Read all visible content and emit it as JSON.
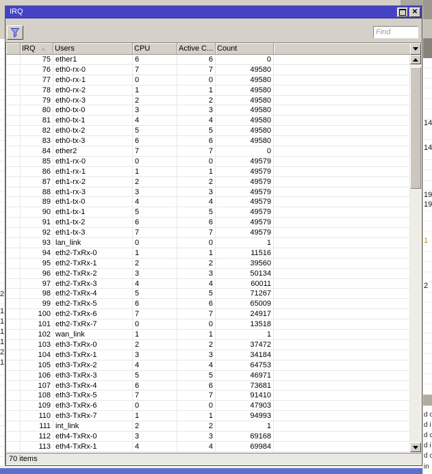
{
  "window": {
    "title": "IRQ"
  },
  "titlebar": {
    "maximize_icon": "maximize",
    "close_icon": "close"
  },
  "toolbar": {
    "find_placeholder": "Find",
    "filter_icon": "funnel"
  },
  "table": {
    "columns": [
      "",
      "IRQ",
      "Users",
      "CPU",
      "Active C...",
      "Count"
    ],
    "sort": {
      "column": "IRQ",
      "direction": "asc"
    },
    "rows": [
      {
        "irq": 75,
        "users": "ether1",
        "cpu": 6,
        "active_cpu": 6,
        "count": 0
      },
      {
        "irq": 76,
        "users": "eth0-rx-0",
        "cpu": 7,
        "active_cpu": 7,
        "count": 49580
      },
      {
        "irq": 77,
        "users": "eth0-rx-1",
        "cpu": 0,
        "active_cpu": 0,
        "count": 49580
      },
      {
        "irq": 78,
        "users": "eth0-rx-2",
        "cpu": 1,
        "active_cpu": 1,
        "count": 49580
      },
      {
        "irq": 79,
        "users": "eth0-rx-3",
        "cpu": 2,
        "active_cpu": 2,
        "count": 49580
      },
      {
        "irq": 80,
        "users": "eth0-tx-0",
        "cpu": 3,
        "active_cpu": 3,
        "count": 49580
      },
      {
        "irq": 81,
        "users": "eth0-tx-1",
        "cpu": 4,
        "active_cpu": 4,
        "count": 49580
      },
      {
        "irq": 82,
        "users": "eth0-tx-2",
        "cpu": 5,
        "active_cpu": 5,
        "count": 49580
      },
      {
        "irq": 83,
        "users": "eth0-tx-3",
        "cpu": 6,
        "active_cpu": 6,
        "count": 49580
      },
      {
        "irq": 84,
        "users": "ether2",
        "cpu": 7,
        "active_cpu": 7,
        "count": 0
      },
      {
        "irq": 85,
        "users": "eth1-rx-0",
        "cpu": 0,
        "active_cpu": 0,
        "count": 49579
      },
      {
        "irq": 86,
        "users": "eth1-rx-1",
        "cpu": 1,
        "active_cpu": 1,
        "count": 49579
      },
      {
        "irq": 87,
        "users": "eth1-rx-2",
        "cpu": 2,
        "active_cpu": 2,
        "count": 49579
      },
      {
        "irq": 88,
        "users": "eth1-rx-3",
        "cpu": 3,
        "active_cpu": 3,
        "count": 49579
      },
      {
        "irq": 89,
        "users": "eth1-tx-0",
        "cpu": 4,
        "active_cpu": 4,
        "count": 49579
      },
      {
        "irq": 90,
        "users": "eth1-tx-1",
        "cpu": 5,
        "active_cpu": 5,
        "count": 49579
      },
      {
        "irq": 91,
        "users": "eth1-tx-2",
        "cpu": 6,
        "active_cpu": 6,
        "count": 49579
      },
      {
        "irq": 92,
        "users": "eth1-tx-3",
        "cpu": 7,
        "active_cpu": 7,
        "count": 49579
      },
      {
        "irq": 93,
        "users": "lan_link",
        "cpu": 0,
        "active_cpu": 0,
        "count": 1
      },
      {
        "irq": 94,
        "users": "eth2-TxRx-0",
        "cpu": 1,
        "active_cpu": 1,
        "count": 11516
      },
      {
        "irq": 95,
        "users": "eth2-TxRx-1",
        "cpu": 2,
        "active_cpu": 2,
        "count": 39560
      },
      {
        "irq": 96,
        "users": "eth2-TxRx-2",
        "cpu": 3,
        "active_cpu": 3,
        "count": 50134
      },
      {
        "irq": 97,
        "users": "eth2-TxRx-3",
        "cpu": 4,
        "active_cpu": 4,
        "count": 60011
      },
      {
        "irq": 98,
        "users": "eth2-TxRx-4",
        "cpu": 5,
        "active_cpu": 5,
        "count": 71267
      },
      {
        "irq": 99,
        "users": "eth2-TxRx-5",
        "cpu": 6,
        "active_cpu": 6,
        "count": 65009
      },
      {
        "irq": 100,
        "users": "eth2-TxRx-6",
        "cpu": 7,
        "active_cpu": 7,
        "count": 24917
      },
      {
        "irq": 101,
        "users": "eth2-TxRx-7",
        "cpu": 0,
        "active_cpu": 0,
        "count": 13518
      },
      {
        "irq": 102,
        "users": "wan_link",
        "cpu": 1,
        "active_cpu": 1,
        "count": 1
      },
      {
        "irq": 103,
        "users": "eth3-TxRx-0",
        "cpu": 2,
        "active_cpu": 2,
        "count": 37472
      },
      {
        "irq": 104,
        "users": "eth3-TxRx-1",
        "cpu": 3,
        "active_cpu": 3,
        "count": 34184
      },
      {
        "irq": 105,
        "users": "eth3-TxRx-2",
        "cpu": 4,
        "active_cpu": 4,
        "count": 64753
      },
      {
        "irq": 106,
        "users": "eth3-TxRx-3",
        "cpu": 5,
        "active_cpu": 5,
        "count": 46971
      },
      {
        "irq": 107,
        "users": "eth3-TxRx-4",
        "cpu": 6,
        "active_cpu": 6,
        "count": 73681
      },
      {
        "irq": 108,
        "users": "eth3-TxRx-5",
        "cpu": 7,
        "active_cpu": 7,
        "count": 91410
      },
      {
        "irq": 109,
        "users": "eth3-TxRx-6",
        "cpu": 0,
        "active_cpu": 0,
        "count": 47903
      },
      {
        "irq": 110,
        "users": "eth3-TxRx-7",
        "cpu": 1,
        "active_cpu": 1,
        "count": 94993
      },
      {
        "irq": 111,
        "users": "int_link",
        "cpu": 2,
        "active_cpu": 2,
        "count": 1
      },
      {
        "irq": 112,
        "users": "eth4-TxRx-0",
        "cpu": 3,
        "active_cpu": 3,
        "count": 69168
      },
      {
        "irq": 113,
        "users": "eth4-TxRx-1",
        "cpu": 4,
        "active_cpu": 4,
        "count": 69984
      }
    ]
  },
  "statusbar": {
    "items_text": "70 items"
  },
  "background": {
    "right_numbers": [
      "14",
      "14",
      "19",
      "19",
      "1",
      "2"
    ],
    "log_fragments": [
      "d o",
      "d i",
      "d c",
      "d i",
      "d o",
      "in"
    ],
    "left_digits": [
      "2",
      "1",
      "1",
      "1",
      "1",
      "2",
      "1"
    ]
  },
  "colors": {
    "titlebar_blue": "#4443c6",
    "taskbar_blue": "#5f6ecb",
    "funnel_blue": "#3939bd",
    "orange_fragment": "#d08a14"
  }
}
